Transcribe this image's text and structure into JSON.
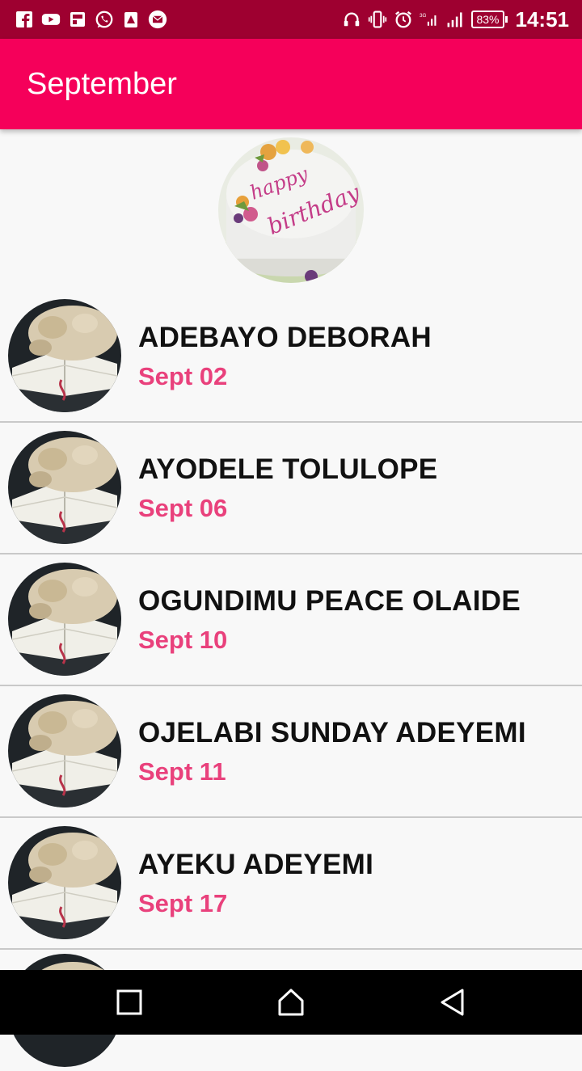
{
  "status_bar": {
    "left_icons": [
      "facebook-icon",
      "youtube-icon",
      "gallery-icon",
      "whatsapp-icon",
      "alert-icon",
      "email-icon"
    ],
    "right_icons": [
      "headset-icon",
      "vibrate-icon",
      "alarm-icon",
      "signal-3g-icon",
      "signal-icon"
    ],
    "battery": "83%",
    "time": "14:51"
  },
  "app_bar": {
    "title": "September"
  },
  "header_image": {
    "icon": "birthday-cake-image"
  },
  "birthdays": [
    {
      "name": "ADEBAYO DEBORAH",
      "date": "Sept 02"
    },
    {
      "name": "AYODELE TOLULOPE",
      "date": "Sept 06"
    },
    {
      "name": "OGUNDIMU PEACE OLAIDE",
      "date": "Sept 10"
    },
    {
      "name": "OJELABI SUNDAY ADEYEMI",
      "date": "Sept 11"
    },
    {
      "name": "AYEKU ADEYEMI",
      "date": "Sept 17"
    }
  ],
  "nav_bar": {
    "buttons": [
      "recents-button",
      "home-button",
      "back-button"
    ]
  },
  "colors": {
    "status_bar": "#9e0030",
    "app_bar": "#f5005a",
    "date_text": "#e9417c",
    "background": "#f8f8f8"
  }
}
